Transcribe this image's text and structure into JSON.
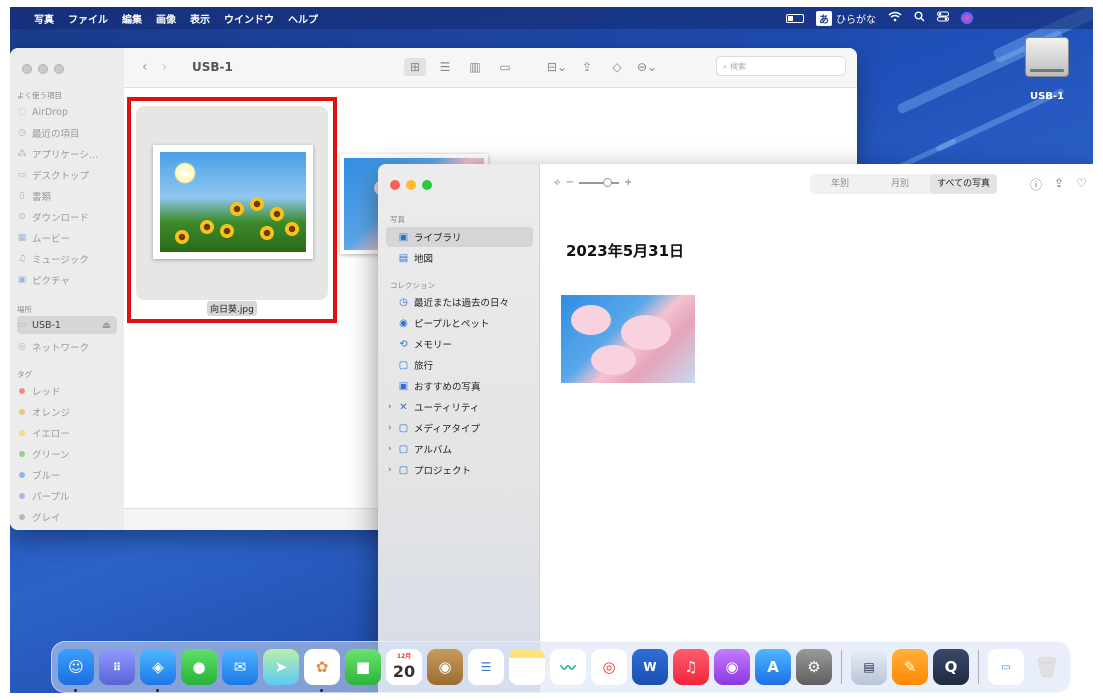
{
  "menubar": {
    "items": [
      "写真",
      "ファイル",
      "編集",
      "画像",
      "表示",
      "ウインドウ",
      "ヘルプ"
    ],
    "ime_badge": "あ",
    "ime_label": "ひらがな"
  },
  "desktop": {
    "usb_label": "USB-1"
  },
  "finder": {
    "title": "USB-1",
    "search_placeholder": "検索",
    "favorites_label": "よく使う項目",
    "favorites": [
      {
        "label": "AirDrop",
        "icon": "airdrop-icon"
      },
      {
        "label": "最近の項目",
        "icon": "clock-icon"
      },
      {
        "label": "アプリケーシ…",
        "icon": "apps-icon"
      },
      {
        "label": "デスクトップ",
        "icon": "desktop-icon"
      },
      {
        "label": "書類",
        "icon": "document-icon"
      },
      {
        "label": "ダウンロード",
        "icon": "download-icon"
      },
      {
        "label": "ムービー",
        "icon": "film-icon"
      },
      {
        "label": "ミュージック",
        "icon": "music-icon"
      },
      {
        "label": "ピクチャ",
        "icon": "picture-icon"
      }
    ],
    "locations_label": "場所",
    "locations": [
      {
        "label": "USB-1",
        "icon": "drive-icon"
      },
      {
        "label": "ネットワーク",
        "icon": "network-icon"
      }
    ],
    "tags_label": "タグ",
    "tags": [
      {
        "label": "レッド",
        "color": "#f08a8a"
      },
      {
        "label": "オレンジ",
        "color": "#f4c27a"
      },
      {
        "label": "イエロー",
        "color": "#f2dc7c"
      },
      {
        "label": "グリーン",
        "color": "#8fd09a"
      },
      {
        "label": "ブルー",
        "color": "#8cb6f0"
      },
      {
        "label": "パープル",
        "color": "#c9a4e6"
      },
      {
        "label": "グレイ",
        "color": "#b8b8b8"
      }
    ],
    "files": [
      {
        "name": "向日葵.jpg"
      }
    ]
  },
  "photos": {
    "section_photos": "写真",
    "library": "ライブラリ",
    "map": "地図",
    "section_collections": "コレクション",
    "collections": [
      "最近または過去の日々",
      "ピープルとペット",
      "メモリー",
      "旅行",
      "おすすめの写真"
    ],
    "groups": [
      "ユーティリティ",
      "メディアタイプ",
      "アルバム",
      "プロジェクト"
    ],
    "view_tabs": [
      "年別",
      "月別",
      "すべての写真"
    ],
    "active_tab": "すべての写真",
    "date_heading": "2023年5月31日"
  },
  "dock": {
    "calendar_month": "12月",
    "calendar_day": "20"
  }
}
